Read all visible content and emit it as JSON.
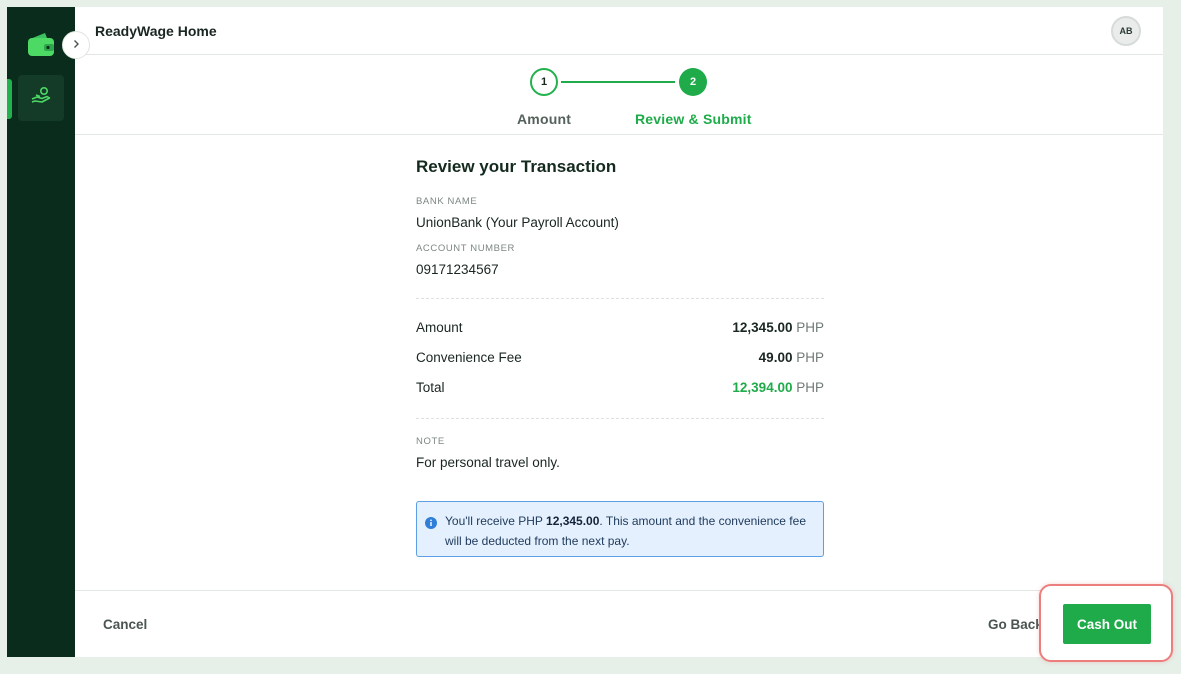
{
  "header": {
    "app_title": "ReadyWage Home",
    "avatar_initials": "AB"
  },
  "stepper": {
    "steps": [
      {
        "number": "1",
        "label": "Amount",
        "state": "completed"
      },
      {
        "number": "2",
        "label": "Review & Submit",
        "state": "active"
      }
    ]
  },
  "review": {
    "title": "Review your Transaction",
    "bank_name_label": "BANK NAME",
    "bank_name_value": "UnionBank (Your Payroll Account)",
    "account_number_label": "ACCOUNT NUMBER",
    "account_number_value": "09171234567",
    "rows": [
      {
        "label": "Amount",
        "value": "12,345.00",
        "currency": "PHP"
      },
      {
        "label": "Convenience Fee",
        "value": "49.00",
        "currency": "PHP"
      },
      {
        "label": "Total",
        "value": "12,394.00",
        "currency": "PHP"
      }
    ],
    "note_label": "NOTE",
    "note_value": "For personal travel only."
  },
  "info": {
    "prefix": "You'll receive PHP ",
    "amount": "12,345.00",
    "suffix": ". This amount and the convenience fee will be deducted from the next pay."
  },
  "footer": {
    "cancel_label": "Cancel",
    "go_back_label": "Go Back",
    "cash_out_label": "Cash Out"
  },
  "colors": {
    "brand_green": "#1fab4a",
    "sidebar_bg": "#0a2c1c",
    "info_border": "#5d9fe6",
    "highlight": "#ec7e7e"
  },
  "icons": {
    "logo": "wallet-icon",
    "collapse": "chevron-right-icon",
    "nav": "hand-money-icon",
    "info": "info-icon"
  }
}
